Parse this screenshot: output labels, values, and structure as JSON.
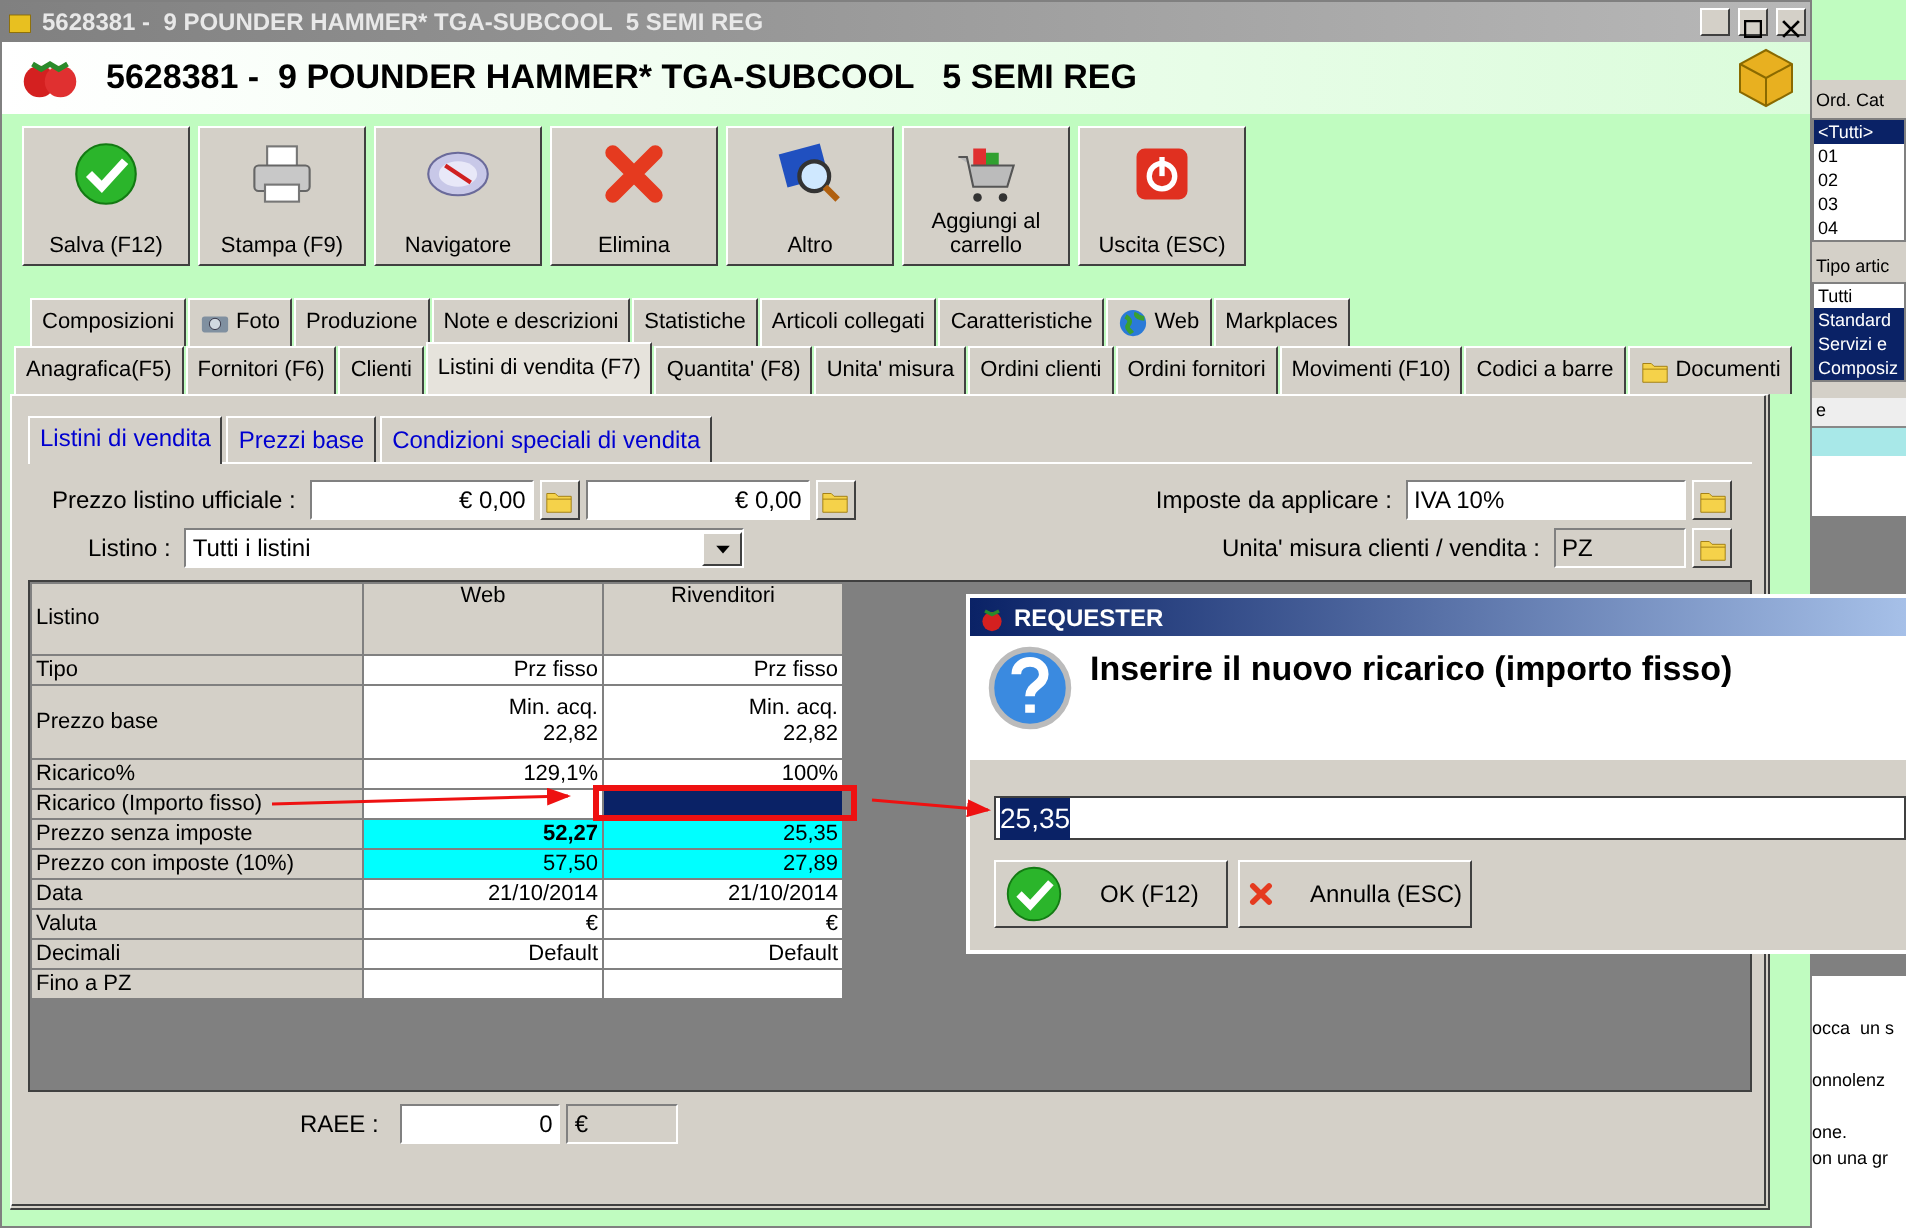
{
  "window": {
    "title": "5628381 -  9 POUNDER HAMMER* TGA-SUBCOOL  5 SEMI REG"
  },
  "header": {
    "title": "5628381 -  9 POUNDER HAMMER* TGA-SUBCOOL   5 SEMI REG"
  },
  "toolbar": [
    {
      "label": "Salva (F12)",
      "kind": "check"
    },
    {
      "label": "Stampa (F9)",
      "kind": "printer"
    },
    {
      "label": "Navigatore",
      "kind": "compass"
    },
    {
      "label": "Elimina",
      "kind": "cross"
    },
    {
      "label": "Altro",
      "kind": "magnifier"
    },
    {
      "label": "Aggiungi al carrello",
      "kind": "cart"
    },
    {
      "label": "Uscita (ESC)",
      "kind": "power"
    }
  ],
  "tabs_top": [
    {
      "label": "Composizioni",
      "selected": false
    },
    {
      "label": "Foto",
      "kind": "camera",
      "selected": false
    },
    {
      "label": "Produzione",
      "selected": false
    },
    {
      "label": "Note e descrizioni",
      "selected": false
    },
    {
      "label": "Statistiche",
      "selected": false
    },
    {
      "label": "Articoli collegati",
      "selected": false
    },
    {
      "label": "Caratteristiche",
      "selected": false
    },
    {
      "label": "Web",
      "kind": "globe",
      "selected": false
    },
    {
      "label": "Markplaces",
      "selected": false
    }
  ],
  "tabs_bottom": [
    {
      "label": "Anagrafica(F5)",
      "selected": false
    },
    {
      "label": "Fornitori (F6)",
      "selected": false
    },
    {
      "label": "Clienti",
      "selected": false
    },
    {
      "label": "Listini di vendita (F7)",
      "selected": true
    },
    {
      "label": "Quantita' (F8)",
      "selected": false
    },
    {
      "label": "Unita' misura",
      "selected": false
    },
    {
      "label": "Ordini clienti",
      "selected": false
    },
    {
      "label": "Ordini fornitori",
      "selected": false
    },
    {
      "label": "Movimenti (F10)",
      "selected": false
    },
    {
      "label": "Codici a barre",
      "selected": false
    },
    {
      "label": "Documenti",
      "kind": "folder",
      "selected": false
    }
  ],
  "subtabs": [
    {
      "label": "Listini di vendita",
      "selected": true
    },
    {
      "label": "Prezzi base",
      "selected": false
    },
    {
      "label": "Condizioni speciali di vendita",
      "selected": false
    }
  ],
  "form": {
    "official_price": {
      "label": "Prezzo listino ufficiale :",
      "values": [
        "€ 0,00",
        "€ 0,00"
      ]
    },
    "price_list": {
      "label": "Listino :",
      "value": "Tutti i listini"
    },
    "taxes": {
      "label": "Imposte da applicare :",
      "value": "IVA 10%"
    },
    "unit": {
      "label": "Unita' misura clienti / vendita :",
      "value": "PZ"
    }
  },
  "table": {
    "columns": [
      "Listino",
      "Web",
      "Rivenditori"
    ],
    "rows": [
      {
        "highlighted": false,
        "cells": [
          {
            "text": "Tipo"
          },
          {
            "text": "Prz fisso",
            "bold": false,
            "selected": false
          },
          {
            "text": "Prz fisso",
            "bold": false,
            "selected": false
          }
        ]
      },
      {
        "highlighted": false,
        "cells": [
          {
            "text": "Prezzo base"
          },
          {
            "text": "Min. acq.\n22,82",
            "bold": false,
            "selected": false
          },
          {
            "text": "Min. acq.\n22,82",
            "bold": false,
            "selected": false
          }
        ]
      },
      {
        "highlighted": false,
        "cells": [
          {
            "text": "Ricarico%"
          },
          {
            "text": "129,1%",
            "bold": false,
            "selected": false
          },
          {
            "text": "100%",
            "bold": false,
            "selected": false
          }
        ]
      },
      {
        "highlighted": false,
        "cells": [
          {
            "text": "Ricarico (Importo fisso)"
          },
          {
            "text": "",
            "selected": false
          },
          {
            "text": "",
            "selected": true
          }
        ]
      },
      {
        "highlighted": true,
        "cells": [
          {
            "text": "Prezzo senza imposte"
          },
          {
            "text": "52,27",
            "bold": true,
            "selected": false
          },
          {
            "text": "25,35",
            "bold": false,
            "selected": false
          }
        ]
      },
      {
        "highlighted": true,
        "cells": [
          {
            "text": "Prezzo con imposte (10%)"
          },
          {
            "text": "57,50",
            "bold": false,
            "selected": false
          },
          {
            "text": "27,89",
            "bold": false,
            "selected": false
          }
        ]
      },
      {
        "highlighted": false,
        "cells": [
          {
            "text": "Data"
          },
          {
            "text": "21/10/2014",
            "bold": false,
            "selected": false
          },
          {
            "text": "21/10/2014",
            "bold": false,
            "selected": false
          }
        ]
      },
      {
        "highlighted": false,
        "cells": [
          {
            "text": "Valuta"
          },
          {
            "text": "€",
            "bold": false,
            "selected": false
          },
          {
            "text": "€",
            "bold": false,
            "selected": false
          }
        ]
      },
      {
        "highlighted": false,
        "cells": [
          {
            "text": "Decimali"
          },
          {
            "text": "Default",
            "bold": false,
            "selected": false
          },
          {
            "text": "Default",
            "bold": false,
            "selected": false
          }
        ]
      },
      {
        "highlighted": false,
        "cells": [
          {
            "text": "Fino a PZ"
          },
          {
            "text": "",
            "selected": false
          },
          {
            "text": "",
            "selected": false
          }
        ]
      }
    ]
  },
  "raee": {
    "label": "RAEE :",
    "value": "0",
    "unit": "€"
  },
  "dialog": {
    "title": "REQUESTER",
    "message": "Inserire il nuovo ricarico (importo fisso)",
    "value": "25,35",
    "buttons": [
      {
        "label": "OK (F12)",
        "kind": "check"
      },
      {
        "label": "Annulla (ESC)",
        "kind": "cross"
      }
    ]
  },
  "background_window": {
    "label_1": "Ord. Cat",
    "list_1": [
      {
        "text": "<Tutti>",
        "selected": true
      },
      {
        "text": "01",
        "selected": false
      },
      {
        "text": "02",
        "selected": false
      },
      {
        "text": "03",
        "selected": false
      },
      {
        "text": "04",
        "selected": false
      }
    ],
    "label_2": "Tipo artic",
    "list_2": [
      {
        "text": "Tutti",
        "selected": false
      },
      {
        "text": "Standard",
        "selected": true
      },
      {
        "text": "Servizi e",
        "selected": true
      },
      {
        "text": "Composiz",
        "selected": true
      }
    ],
    "column_header": "e",
    "text_lines": [
      "occa  un s",
      "onnolenz",
      "one.",
      "on una gr"
    ]
  }
}
